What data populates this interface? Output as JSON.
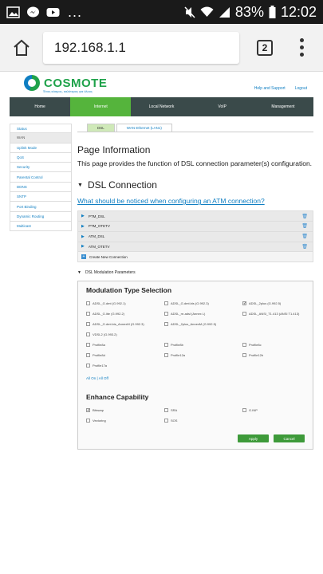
{
  "statusbar": {
    "icons": [
      "gallery-icon",
      "messenger-icon",
      "youtube-icon"
    ],
    "dots": "...",
    "battery": "83%",
    "time": "12:02"
  },
  "browser": {
    "url": "192.168.1.1",
    "tab_count": "2"
  },
  "header": {
    "brand": "COSMOTE",
    "tagline": "Ένας κόσμος, καλύτερος για όλους",
    "links": [
      "Help and Support",
      "Logout"
    ],
    "colors": {
      "brand_green": "#1fa24a",
      "brand_blue": "#0f7ec2"
    }
  },
  "nav": {
    "items": [
      "Home",
      "Internet",
      "Local Network",
      "VoIP",
      "Management"
    ],
    "active": "Internet",
    "active_color": "#55b43c"
  },
  "sidebar": {
    "items": [
      "Status",
      "WAN",
      "Uplink Mode",
      "QoS",
      "Security",
      "Parental Control",
      "DDNS",
      "SNTP",
      "Port Binding",
      "Dynamic Routing",
      "Multicast"
    ]
  },
  "subtabs": [
    "DSL",
    "WAN Ethernet (LAN1)"
  ],
  "content": {
    "title": "Page Information",
    "description": "This page provides the function of DSL connection parameter(s) configuration.",
    "section_title": "DSL Connection",
    "help_link": "What should be noticed when configuring an ATM connection?",
    "connections": [
      "PTM_DSL",
      "PTM_OTETV",
      "ATM_DSL",
      "ATM_OTETV"
    ],
    "new_connection": "Create New Connection",
    "params_toggle": "DSL Modulation Parameters"
  },
  "modulation": {
    "title": "Modulation Type Selection",
    "options": [
      {
        "label": "ADSL_G.dmt (G.992.1)",
        "checked": false
      },
      {
        "label": "ADSL_G.dmt.bis (G.992.3)",
        "checked": false
      },
      {
        "label": "ADSL_2plus (G.992.5)",
        "checked": true
      },
      {
        "label": "ADSL_G.lite (G.992.2)",
        "checked": false
      },
      {
        "label": "ADSL_re-adsl (Annex L)",
        "checked": false
      },
      {
        "label": "ADSL_ANSI_T1.413 (ANSI T1.413)",
        "checked": false
      },
      {
        "label": "ADSL_G.dmt.bis_AnnexM (G.992.3)",
        "checked": false
      },
      {
        "label": "ADSL_2plus_AnnexM (G.992.5)",
        "checked": false
      },
      {
        "label": "",
        "checked": null
      },
      {
        "label": "VDSL2 (G.993.2)",
        "checked": false
      },
      {
        "label": "",
        "checked": null
      },
      {
        "label": "",
        "checked": null
      },
      {
        "label": "Profile8a",
        "checked": false
      },
      {
        "label": "Profile8b",
        "checked": false
      },
      {
        "label": "Profile8c",
        "checked": false
      },
      {
        "label": "Profile8d",
        "checked": false
      },
      {
        "label": "Profile12a",
        "checked": false
      },
      {
        "label": "Profile12b",
        "checked": false
      },
      {
        "label": "Profile17a",
        "checked": false
      }
    ],
    "all_on": "All On",
    "separator": "|",
    "all_off": "All Off"
  },
  "capability": {
    "title": "Enhance Capability",
    "options": [
      {
        "label": "Bitswap",
        "checked": true
      },
      {
        "label": "SRA",
        "checked": false
      },
      {
        "label": "G.INP",
        "checked": false
      },
      {
        "label": "Vectoring",
        "checked": false
      },
      {
        "label": "SOS",
        "checked": false
      }
    ]
  },
  "actions": {
    "apply": "Apply",
    "cancel": "Cancel"
  }
}
